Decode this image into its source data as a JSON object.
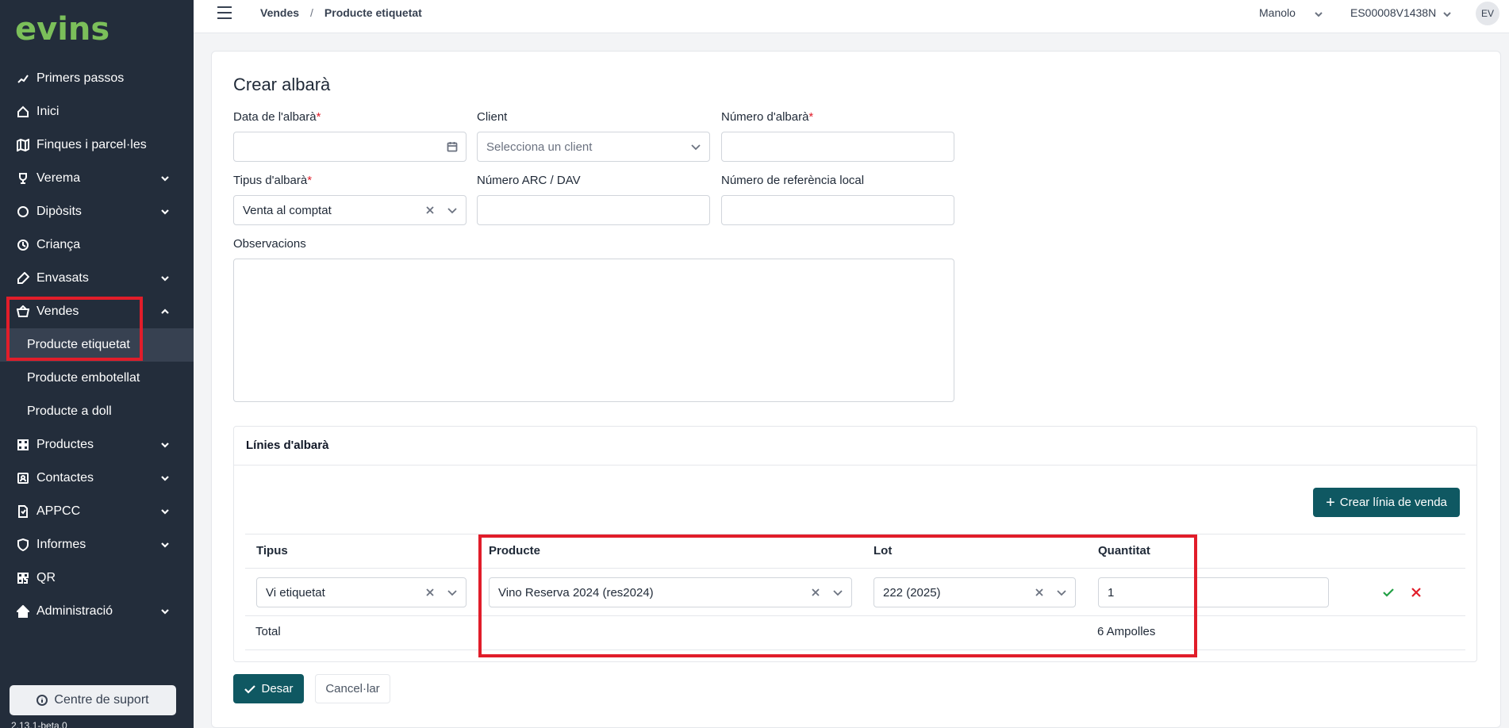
{
  "app": {
    "logo": "evins",
    "version": "2.13.1-beta.0"
  },
  "sidebar": {
    "items": [
      {
        "label": "Primers passos",
        "icon": "steps-icon"
      },
      {
        "label": "Inici",
        "icon": "home-icon"
      },
      {
        "label": "Finques i parcel·les",
        "icon": "map-icon"
      },
      {
        "label": "Verema",
        "icon": "trophy-icon"
      },
      {
        "label": "Dipòsits",
        "icon": "circle-icon"
      },
      {
        "label": "Criança",
        "icon": "clock-icon"
      },
      {
        "label": "Envasats",
        "icon": "bottle-icon"
      },
      {
        "label": "Vendes",
        "icon": "basket-icon"
      }
    ],
    "vendes_sub": [
      "Producte etiquetat",
      "Producte embotellat",
      "Producte a doll"
    ],
    "items_after": [
      {
        "label": "Productes",
        "icon": "grid-icon"
      },
      {
        "label": "Contactes",
        "icon": "contact-icon"
      },
      {
        "label": "APPCC",
        "icon": "document-icon"
      },
      {
        "label": "Informes",
        "icon": "shield-icon"
      },
      {
        "label": "QR",
        "icon": "qr-icon"
      },
      {
        "label": "Administració",
        "icon": "house-icon"
      }
    ],
    "support": "Centre de suport"
  },
  "topbar": {
    "breadcrumb": [
      "Vendes",
      "/",
      "Producte etiquetat"
    ],
    "user": "Manolo",
    "entity": "ES00008V1438N",
    "avatar": "EV"
  },
  "form": {
    "title": "Crear albarà",
    "date_label": "Data de l'albarà",
    "client_label": "Client",
    "client_placeholder": "Selecciona un client",
    "number_label": "Número d'albarà",
    "type_label": "Tipus d'albarà",
    "type_value": "Venta al comptat",
    "arc_label": "Número ARC / DAV",
    "ref_label": "Número de referència local",
    "obs_label": "Observacions",
    "required_mark": "*"
  },
  "lines": {
    "title": "Línies d'albarà",
    "create_button": "Crear línia de venda",
    "headers": [
      "Tipus",
      "Producte",
      "Lot",
      "Quantitat"
    ],
    "row": {
      "tipus": "Vi etiquetat",
      "producte": "Vino Reserva 2024 (res2024)",
      "lot": "222 (2025)",
      "quantitat": "1"
    },
    "total_label": "Total",
    "total_value": "6 Ampolles"
  },
  "actions": {
    "save": "Desar",
    "cancel": "Cancel·lar"
  },
  "colors": {
    "sidebar": "#232d3b",
    "primary": "#0f5862",
    "highlight": "#e11d2a",
    "logo": "#7bbf5a"
  }
}
